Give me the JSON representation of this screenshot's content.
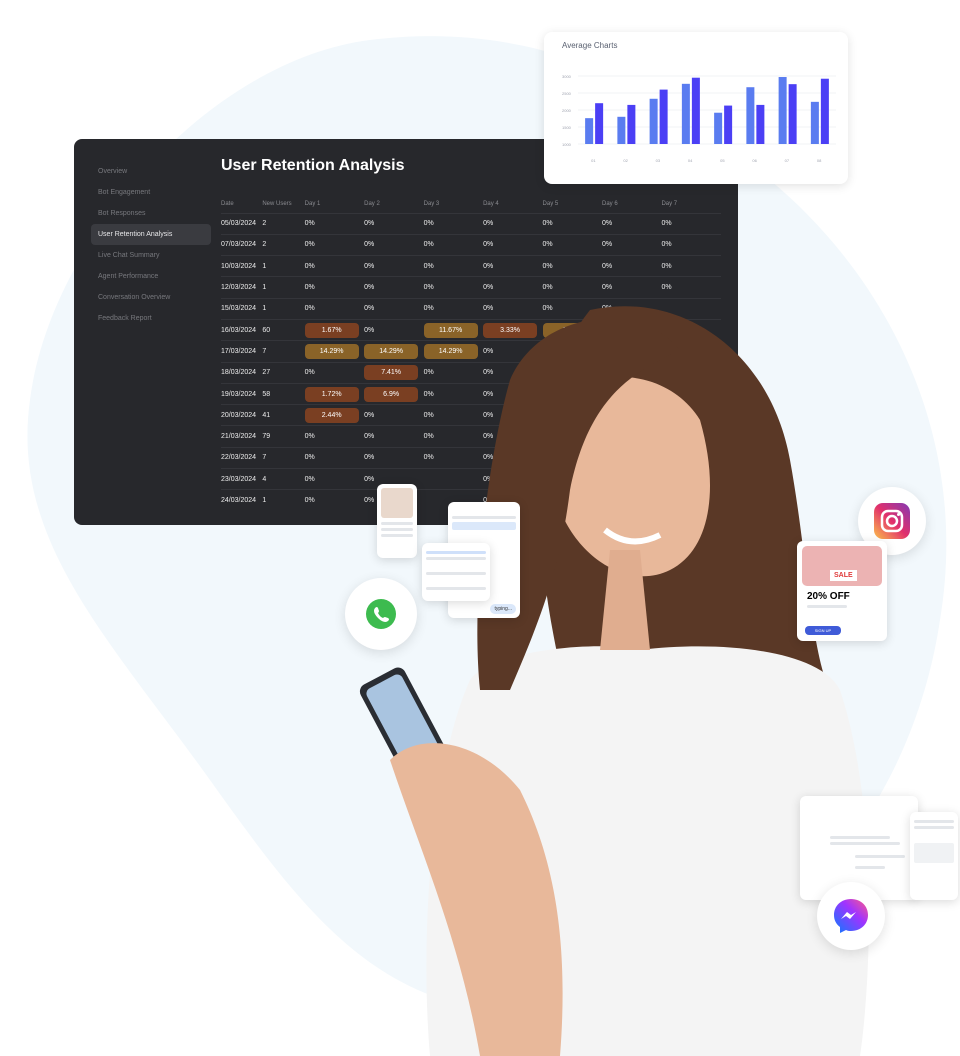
{
  "dashboard": {
    "sidebar": [
      "Overview",
      "Bot Engagement",
      "Bot Responses",
      "User Retention Analysis",
      "Live Chat Summary",
      "Agent Performance",
      "Conversation Overview",
      "Feedback Report"
    ],
    "active_index": 3,
    "title": "User Retention Analysis",
    "columns": [
      "Date",
      "New Users",
      "Day 1",
      "Day 2",
      "Day 3",
      "Day 4",
      "Day 5",
      "Day 6",
      "Day 7"
    ],
    "rows": [
      {
        "date": "05/03/2024",
        "users": "2",
        "days": [
          "0%",
          "0%",
          "0%",
          "0%",
          "0%",
          "0%",
          "0%"
        ]
      },
      {
        "date": "07/03/2024",
        "users": "2",
        "days": [
          "0%",
          "0%",
          "0%",
          "0%",
          "0%",
          "0%",
          "0%"
        ]
      },
      {
        "date": "10/03/2024",
        "users": "1",
        "days": [
          "0%",
          "0%",
          "0%",
          "0%",
          "0%",
          "0%",
          "0%"
        ]
      },
      {
        "date": "12/03/2024",
        "users": "1",
        "days": [
          "0%",
          "0%",
          "0%",
          "0%",
          "0%",
          "0%",
          "0%"
        ]
      },
      {
        "date": "15/03/2024",
        "users": "1",
        "days": [
          "0%",
          "0%",
          "0%",
          "0%",
          "0%",
          "0%",
          null
        ]
      },
      {
        "date": "16/03/2024",
        "users": "60",
        "days": [
          "1.67%",
          "0%",
          "11.67%",
          "3.33%",
          "10%",
          null,
          null
        ]
      },
      {
        "date": "17/03/2024",
        "users": "7",
        "days": [
          "14.29%",
          "14.29%",
          "14.29%",
          "0%",
          "0%",
          null,
          null
        ]
      },
      {
        "date": "18/03/2024",
        "users": "27",
        "days": [
          "0%",
          "7.41%",
          "0%",
          "0%",
          "0%",
          null,
          null
        ]
      },
      {
        "date": "19/03/2024",
        "users": "58",
        "days": [
          "1.72%",
          "6.9%",
          "0%",
          "0%",
          null,
          null,
          null
        ]
      },
      {
        "date": "20/03/2024",
        "users": "41",
        "days": [
          "2.44%",
          "0%",
          "0%",
          "0%",
          null,
          null,
          null
        ]
      },
      {
        "date": "21/03/2024",
        "users": "79",
        "days": [
          "0%",
          "0%",
          "0%",
          "0%",
          null,
          null,
          null
        ]
      },
      {
        "date": "22/03/2024",
        "users": "7",
        "days": [
          "0%",
          "0%",
          "0%",
          "0%",
          null,
          null,
          null
        ]
      },
      {
        "date": "23/03/2024",
        "users": "4",
        "days": [
          "0%",
          "0%",
          null,
          "0%",
          null,
          null,
          null
        ]
      },
      {
        "date": "24/03/2024",
        "users": "1",
        "days": [
          "0%",
          "0%",
          null,
          "0%",
          null,
          null,
          null
        ]
      }
    ],
    "colors": {
      "low": "#7a3f22",
      "high": "#8a6328"
    }
  },
  "chart_data": {
    "type": "bar",
    "title": "Average Charts",
    "categories": [
      "01",
      "02",
      "03",
      "04",
      "05",
      "06",
      "07",
      "08"
    ],
    "series": [
      {
        "name": "A",
        "color": "#5a7cf0",
        "values": [
          1760,
          1800,
          2330,
          2770,
          1920,
          2670,
          2970,
          2240
        ]
      },
      {
        "name": "B",
        "color": "#4b3ff5",
        "values": [
          2200,
          2150,
          2600,
          2950,
          2130,
          2150,
          2760,
          2920
        ]
      }
    ],
    "yticks": [
      1000,
      1500,
      2000,
      2500,
      3000
    ],
    "ylim": [
      1000,
      3000
    ]
  },
  "promo": {
    "sale": "SALE",
    "offer": "20% OFF",
    "button": "SIGN UP"
  },
  "chat": {
    "typing": "typing..."
  }
}
